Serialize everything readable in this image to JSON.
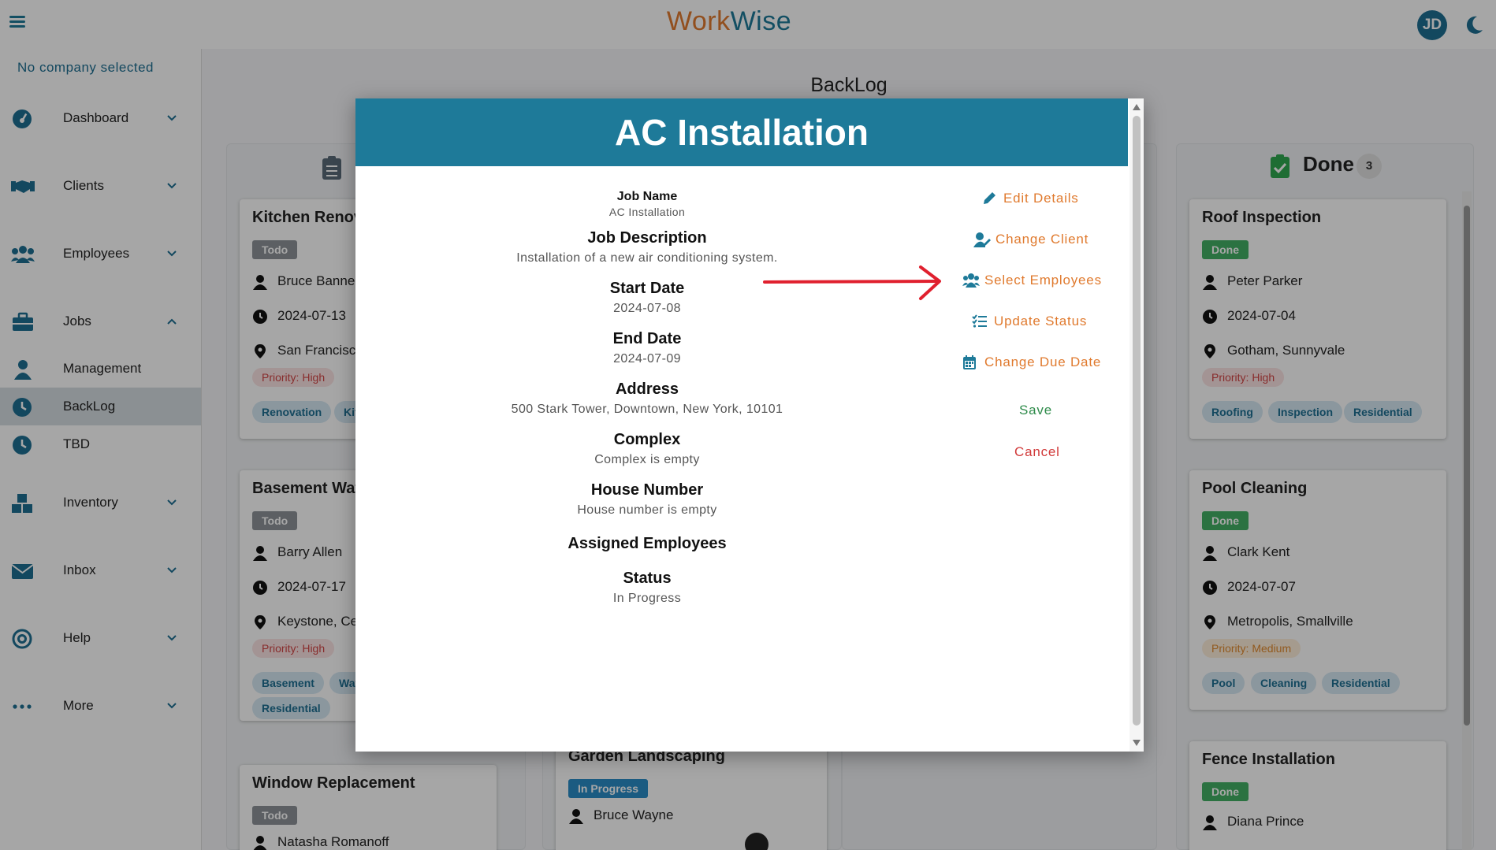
{
  "app": {
    "brand_part1": "Work",
    "brand_part2": "Wise",
    "user_initials": "JD"
  },
  "sidebar": {
    "company": "No company selected",
    "items": [
      {
        "label": "Dashboard"
      },
      {
        "label": "Clients"
      },
      {
        "label": "Employees"
      },
      {
        "label": "Jobs"
      },
      {
        "label": "Management"
      },
      {
        "label": "BackLog"
      },
      {
        "label": "TBD"
      },
      {
        "label": "Inventory"
      },
      {
        "label": "Inbox"
      },
      {
        "label": "Help"
      },
      {
        "label": "More"
      }
    ]
  },
  "page": {
    "title": "BackLog"
  },
  "columns": {
    "todo": {
      "cards": [
        {
          "title": "Kitchen Renovation",
          "status": "Todo",
          "person": "Bruce Banner",
          "date": "2024-07-13",
          "location": "San Francisco",
          "priority": "Priority: High",
          "tags": [
            "Renovation",
            "Kitchen"
          ]
        },
        {
          "title": "Basement Waterproofing",
          "status": "Todo",
          "person": "Barry Allen",
          "date": "2024-07-17",
          "location": "Keystone, Central",
          "priority": "Priority: High",
          "tags": [
            "Basement",
            "Waterproofing",
            "Residential"
          ]
        },
        {
          "title": "Window Replacement",
          "status": "Todo",
          "person": "Natasha Romanoff"
        }
      ]
    },
    "inprogress": {
      "cards": [
        {
          "title": "Garden Landscaping",
          "status": "In Progress",
          "person": "Bruce Wayne"
        }
      ]
    },
    "done": {
      "title": "Done",
      "count": "3",
      "cards": [
        {
          "title": "Roof Inspection",
          "status": "Done",
          "person": "Peter Parker",
          "date": "2024-07-04",
          "location": "Gotham, Sunnyvale",
          "priority": "Priority: High",
          "tags": [
            "Roofing",
            "Inspection",
            "Residential"
          ]
        },
        {
          "title": "Pool Cleaning",
          "status": "Done",
          "person": "Clark Kent",
          "date": "2024-07-07",
          "location": "Metropolis, Smallville",
          "priority": "Priority: Medium",
          "tags": [
            "Pool",
            "Cleaning",
            "Residential"
          ]
        },
        {
          "title": "Fence Installation",
          "status": "Done",
          "person": "Diana Prince"
        }
      ]
    }
  },
  "modal": {
    "title": "AC Installation",
    "fields": [
      {
        "label": "Job Name",
        "value": "AC Installation"
      },
      {
        "label": "Job Description",
        "value": "Installation of a new air conditioning system."
      },
      {
        "label": "Start Date",
        "value": "2024-07-08"
      },
      {
        "label": "End Date",
        "value": "2024-07-09"
      },
      {
        "label": "Address",
        "value": "500 Stark Tower, Downtown, New York, 10101"
      },
      {
        "label": "Complex",
        "value": "Complex is empty"
      },
      {
        "label": "House Number",
        "value": "House number is empty"
      },
      {
        "label": "Assigned Employees",
        "value": ""
      },
      {
        "label": "Status",
        "value": "In Progress"
      }
    ],
    "actions": {
      "edit": "Edit Details",
      "client": "Change Client",
      "employees": "Select Employees",
      "status": "Update Status",
      "due": "Change Due Date",
      "save": "Save",
      "cancel": "Cancel"
    }
  },
  "colors": {
    "primary": "#1e7a99",
    "accent": "#e07a2e",
    "annotation_arrow": "#e0202e"
  }
}
